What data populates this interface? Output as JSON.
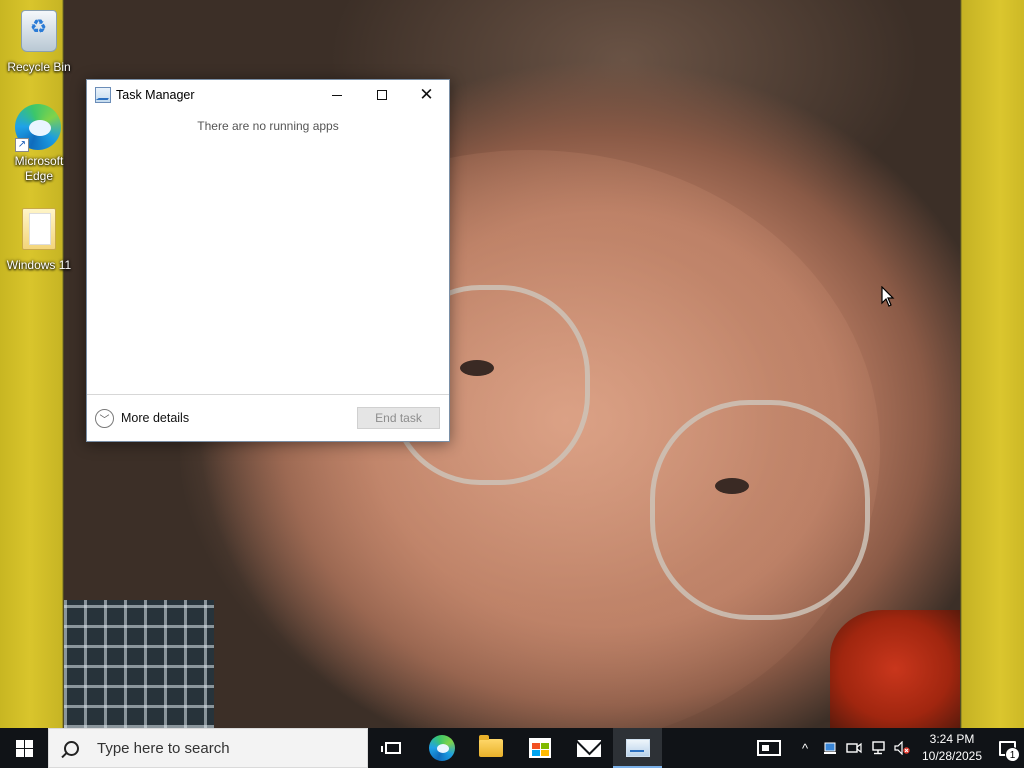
{
  "desktop": {
    "icons": [
      {
        "label": "Recycle Bin",
        "icon": "recycle-bin-icon"
      },
      {
        "label": "Microsoft Edge",
        "icon": "edge-icon"
      },
      {
        "label": "Windows 11",
        "icon": "folder-icon"
      }
    ]
  },
  "task_manager": {
    "title": "Task Manager",
    "empty_message": "There are no running apps",
    "more_details_label": "More details",
    "end_task_label": "End task",
    "minimize_glyph": "—",
    "close_glyph": "✕"
  },
  "taskbar": {
    "search_placeholder": "Type here to search",
    "apps": [
      "task-view",
      "microsoft-edge",
      "file-explorer",
      "microsoft-store",
      "mail",
      "task-manager"
    ],
    "active_app": "task-manager",
    "accent_color": "#7ab0e8",
    "background_color": "#101317"
  },
  "tray": {
    "chevron": "^",
    "time": "3:24 PM",
    "date": "10/28/2025",
    "notification_count": "1"
  }
}
